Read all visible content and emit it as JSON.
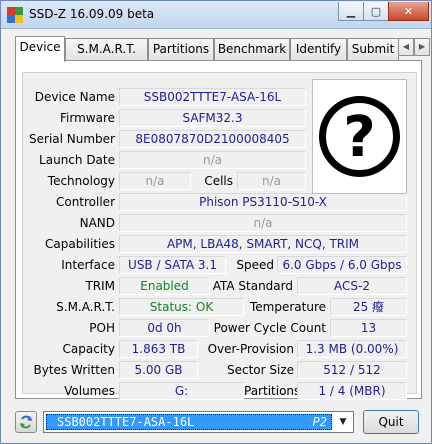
{
  "window": {
    "title": "SSD-Z 16.09.09 beta",
    "controls": {
      "minimize": "▁",
      "maximize": "▢",
      "close": "✕"
    }
  },
  "tabs": [
    {
      "label": "Device",
      "active": true
    },
    {
      "label": "S.M.A.R.T."
    },
    {
      "label": "Partitions"
    },
    {
      "label": "Benchmark"
    },
    {
      "label": "Identify"
    },
    {
      "label": "Submit"
    }
  ],
  "tab_scroll": {
    "left": "◀",
    "right": "▶"
  },
  "device": {
    "device_name": {
      "label": "Device Name",
      "value": "SSB002TTTE7-ASA-16L"
    },
    "firmware": {
      "label": "Firmware",
      "value": "SAFM32.3"
    },
    "serial_number": {
      "label": "Serial Number",
      "value": "8E0807870D2100008405"
    },
    "launch_date": {
      "label": "Launch Date",
      "value": "n/a"
    },
    "technology": {
      "label": "Technology",
      "value": "n/a"
    },
    "cells": {
      "label": "Cells",
      "value": "n/a"
    },
    "controller": {
      "label": "Controller",
      "value": "Phison PS3110-S10-X"
    },
    "nand": {
      "label": "NAND",
      "value": "n/a"
    },
    "capabilities": {
      "label": "Capabilities",
      "value": "APM, LBA48, SMART, NCQ, TRIM"
    },
    "interface": {
      "label": "Interface",
      "value": "USB / SATA 3.1"
    },
    "speed": {
      "label": "Speed",
      "value": "6.0 Gbps / 6.0 Gbps"
    },
    "trim": {
      "label": "TRIM",
      "value": "Enabled"
    },
    "ata_standard": {
      "label": "ATA Standard",
      "value": "ACS-2"
    },
    "smart": {
      "label": "S.M.A.R.T.",
      "value": "Status: OK"
    },
    "temperature": {
      "label": "Temperature",
      "value": "25 癈"
    },
    "poh": {
      "label": "POH",
      "value": "0d 0h"
    },
    "power_cycle_count": {
      "label": "Power Cycle Count",
      "value": "13"
    },
    "capacity": {
      "label": "Capacity",
      "value": "1.863 TB"
    },
    "over_provision": {
      "label": "Over-Provision",
      "value": "1.3 MB (0.00%)"
    },
    "bytes_written": {
      "label": "Bytes Written",
      "value": "5.00 GB"
    },
    "sector_size": {
      "label": "Sector Size",
      "value": "512 / 512"
    },
    "volumes": {
      "label": "Volumes",
      "value": "G:"
    },
    "partitions": {
      "label": "Partitions",
      "value": "1 / 4 (MBR)"
    }
  },
  "logo": {
    "icon": "question-mark-icon",
    "glyph": "?"
  },
  "footer": {
    "drive_select": {
      "value": "SSB002TTTE7-ASA-16L",
      "suffix": "P2",
      "arrow": "▼"
    },
    "quit_label": "Quit"
  }
}
